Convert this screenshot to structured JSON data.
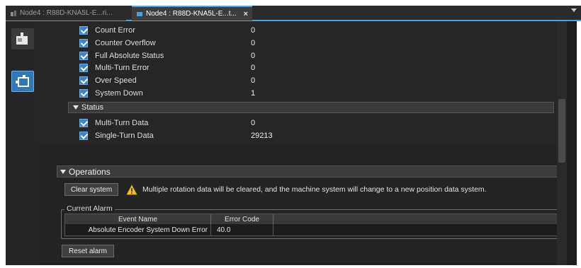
{
  "tabs": [
    {
      "label": "Node4 : R88D-KNA5L-E...ri...",
      "active": false
    },
    {
      "label": "Node4 : R88D-KNA5L-E...t...",
      "active": true,
      "close": "×"
    }
  ],
  "properties": [
    {
      "name": "Count Error",
      "value": "0"
    },
    {
      "name": "Counter Overflow",
      "value": "0"
    },
    {
      "name": "Full Absolute Status",
      "value": "0"
    },
    {
      "name": "Multi-Turn Error",
      "value": "0"
    },
    {
      "name": "Over Speed",
      "value": "0"
    },
    {
      "name": "System Down",
      "value": "1"
    }
  ],
  "status_group": {
    "label": "Status",
    "items": [
      {
        "name": "Multi-Turn Data",
        "value": "0"
      },
      {
        "name": "Single-Turn Data",
        "value": "29213"
      }
    ]
  },
  "operations": {
    "label": "Operations",
    "clear_button": "Clear system",
    "warning_text": "Multiple rotation data will be cleared, and the machine system will change to a new position data system.",
    "reset_button": "Reset alarm"
  },
  "current_alarm": {
    "label": "Current Alarm",
    "columns": [
      "Event Name",
      "Error Code"
    ],
    "rows": [
      {
        "event_name": "Absolute Encoder System Down Error",
        "error_code": "40.0"
      }
    ]
  },
  "colors": {
    "accent": "#4aa3df",
    "checkbox": "#3a85c9",
    "warning": "#f5c518"
  },
  "icons": {
    "side_button_1": "node-device-icon",
    "side_button_2": "node-device-selected-icon",
    "warning": "warning-icon"
  }
}
